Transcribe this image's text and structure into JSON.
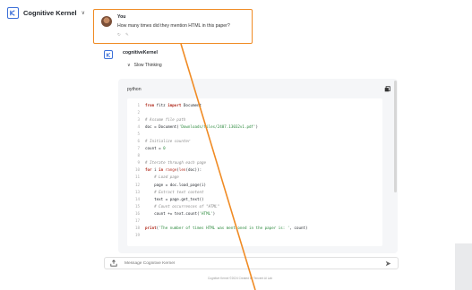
{
  "app": {
    "title": "Cognitive Kernel"
  },
  "user_message": {
    "name": "You",
    "text": "How many times did they mention HTML in this paper?",
    "actions": "↻ ✎"
  },
  "bot_message": {
    "name": "cognitiveKernel",
    "thinking_label": "Slow Thinking"
  },
  "code": {
    "language": "python",
    "lines": [
      [
        {
          "t": "from",
          "c": "kw"
        },
        {
          "t": " fitz "
        },
        {
          "t": "import",
          "c": "kw"
        },
        {
          "t": " Document"
        }
      ],
      [],
      [
        {
          "t": "# Assume file path",
          "c": "cm"
        }
      ],
      [
        {
          "t": "doc = Document("
        },
        {
          "t": "'Downloads/files/2407.13032v1.pdf'",
          "c": "st"
        },
        {
          "t": ")"
        }
      ],
      [],
      [
        {
          "t": "# Initialize counter",
          "c": "cm"
        }
      ],
      [
        {
          "t": "count = "
        },
        {
          "t": "0",
          "c": "nm"
        }
      ],
      [],
      [
        {
          "t": "# Iterate through each page",
          "c": "cm"
        }
      ],
      [
        {
          "t": "for",
          "c": "kw"
        },
        {
          "t": " i "
        },
        {
          "t": "in",
          "c": "kw"
        },
        {
          "t": " "
        },
        {
          "t": "range",
          "c": "fn"
        },
        {
          "t": "("
        },
        {
          "t": "len",
          "c": "fn"
        },
        {
          "t": "(doc)):"
        }
      ],
      [
        {
          "t": "    # Load page",
          "c": "cm"
        }
      ],
      [
        {
          "t": "    page = doc.load_page(i)"
        }
      ],
      [
        {
          "t": "    # Extract text content",
          "c": "cm"
        }
      ],
      [
        {
          "t": "    text = page.get_text()"
        }
      ],
      [
        {
          "t": "    # Count occurrences of \"HTML\"",
          "c": "cm"
        }
      ],
      [
        {
          "t": "    count += text.count("
        },
        {
          "t": "'HTML'",
          "c": "st"
        },
        {
          "t": ")"
        }
      ],
      [],
      [
        {
          "t": "print",
          "c": "kw"
        },
        {
          "t": "("
        },
        {
          "t": "'The number of times HTML was mentioned in the paper is: '",
          "c": "st"
        },
        {
          "t": ", count)"
        }
      ],
      []
    ]
  },
  "composer": {
    "placeholder": "Message Cognitive Kernel"
  },
  "footer": {
    "text": "Cognitive Kernel ©2024 Created by Tencent AI Lab"
  },
  "colors": {
    "annotation": "#f08b24",
    "accent": "#3b6fd8"
  },
  "icons": [
    "kernel-logo-icon",
    "chevron-down-icon",
    "avatar",
    "copy-icon",
    "attach-icon",
    "send-icon"
  ]
}
